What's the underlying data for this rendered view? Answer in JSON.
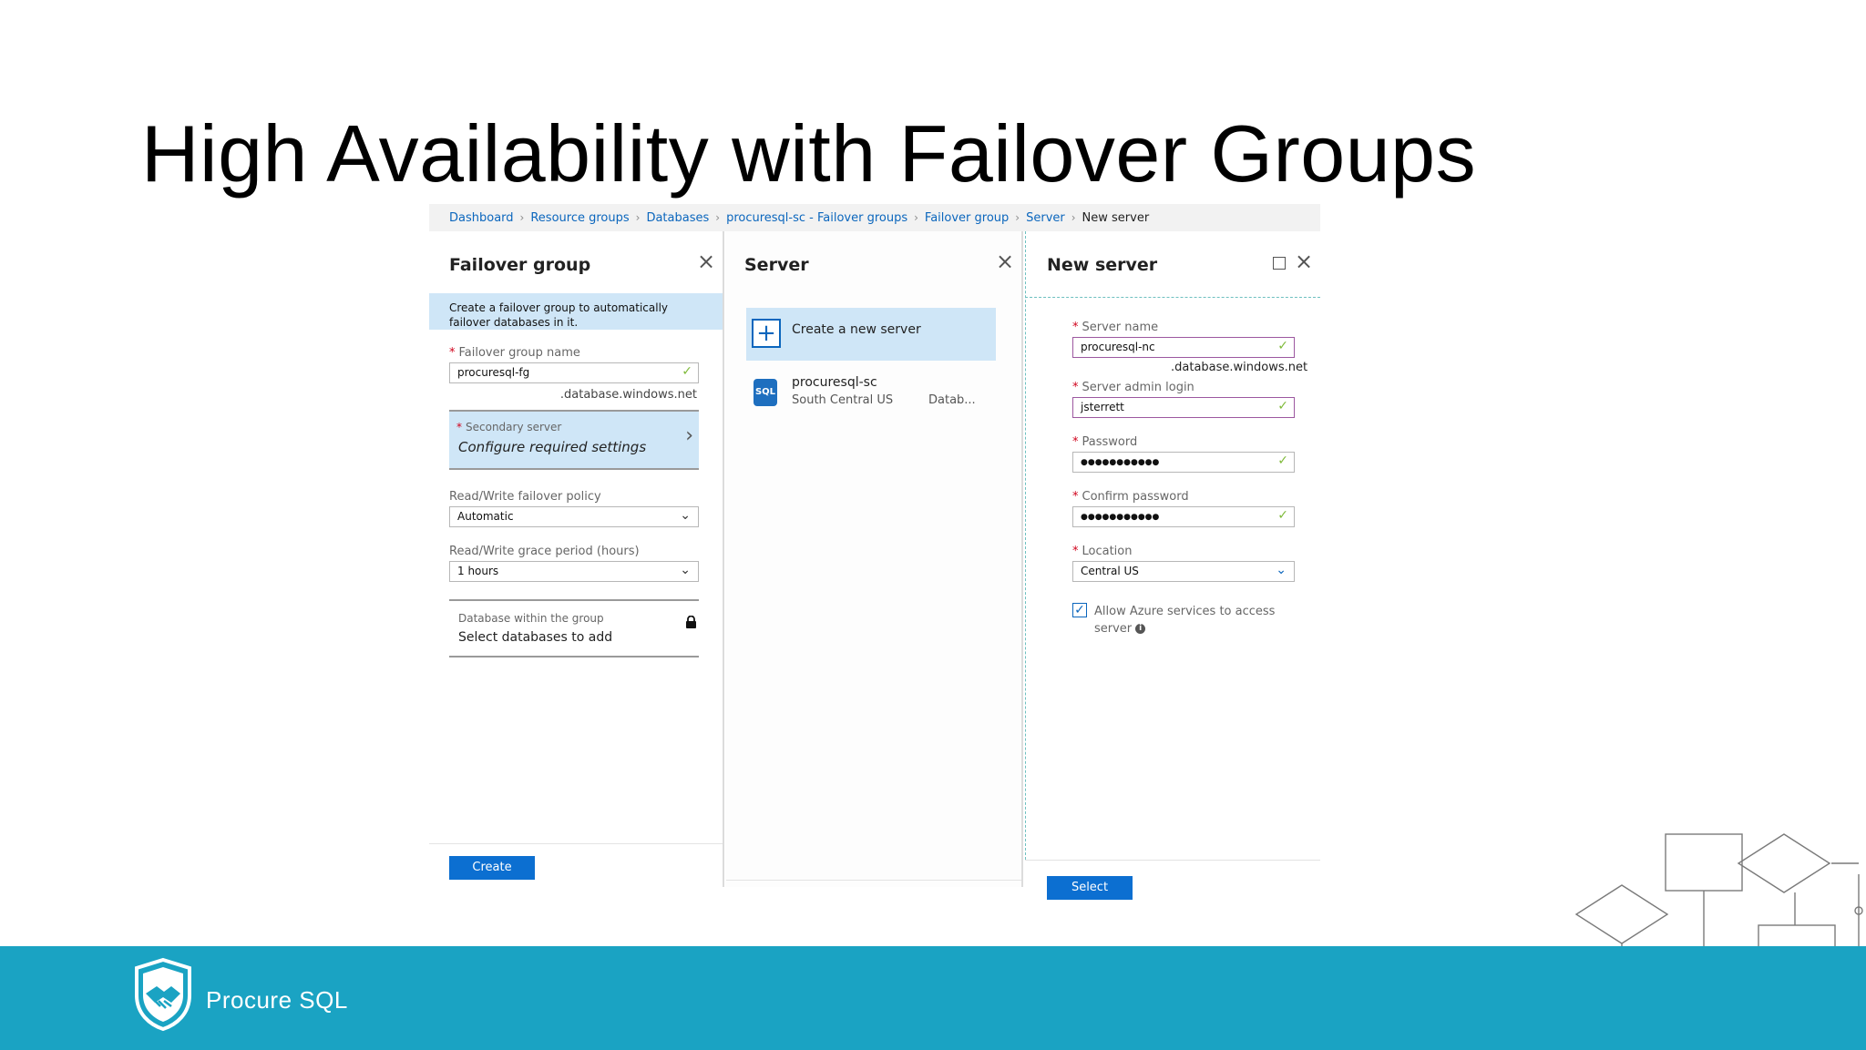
{
  "slide": {
    "title": "High Availability with Failover Groups",
    "brand": "Procure SQL"
  },
  "breadcrumb": [
    "Dashboard",
    "Resource groups",
    "Databases",
    "procuresql-sc - Failover groups",
    "Failover group",
    "Server",
    "New server"
  ],
  "failover_blade": {
    "title": "Failover group",
    "info": "Create a failover group to automatically failover databases in it.",
    "name_label": "Failover group name",
    "name_value": "procuresql-fg",
    "name_suffix": ".database.windows.net",
    "secondary_label": "Secondary server",
    "secondary_value": "Configure required settings",
    "policy_label": "Read/Write failover policy",
    "policy_value": "Automatic",
    "grace_label": "Read/Write grace period (hours)",
    "grace_value": "1 hours",
    "db_label": "Database within the group",
    "db_value": "Select databases to add",
    "create_label": "Create"
  },
  "server_blade": {
    "title": "Server",
    "create_new": "Create a new server",
    "server_name": "procuresql-sc",
    "server_location": "South Central US",
    "server_type": "Datab...",
    "sql_badge": "SQL"
  },
  "new_server_blade": {
    "title": "New server",
    "server_name_label": "Server name",
    "server_name_value": "procuresql-nc",
    "server_name_suffix": ".database.windows.net",
    "admin_label": "Server admin login",
    "admin_value": "jsterrett",
    "password_label": "Password",
    "password_value": "●●●●●●●●●●●",
    "confirm_label": "Confirm password",
    "confirm_value": "●●●●●●●●●●●",
    "location_label": "Location",
    "location_value": "Central US",
    "allow_label": "Allow Azure services to access server",
    "allow_checked": true,
    "select_label": "Select"
  },
  "icons": {
    "close": "close-icon",
    "maximize": "maximize-icon",
    "chevron": "chevron-down-icon",
    "arrow": "chevron-right-icon",
    "lock": "lock-icon",
    "plus": "plus-icon",
    "check": "check-icon",
    "info": "info-icon",
    "sql": "sql-database-icon",
    "logo": "shield-handshake-logo"
  },
  "colors": {
    "footer_band": "#1aa3c3",
    "link_blue": "#0b66bd",
    "button_blue": "#0c6fd1",
    "info_bg": "#cfe6f7",
    "required": "#d0021b",
    "valid_check": "#7fba3a"
  }
}
